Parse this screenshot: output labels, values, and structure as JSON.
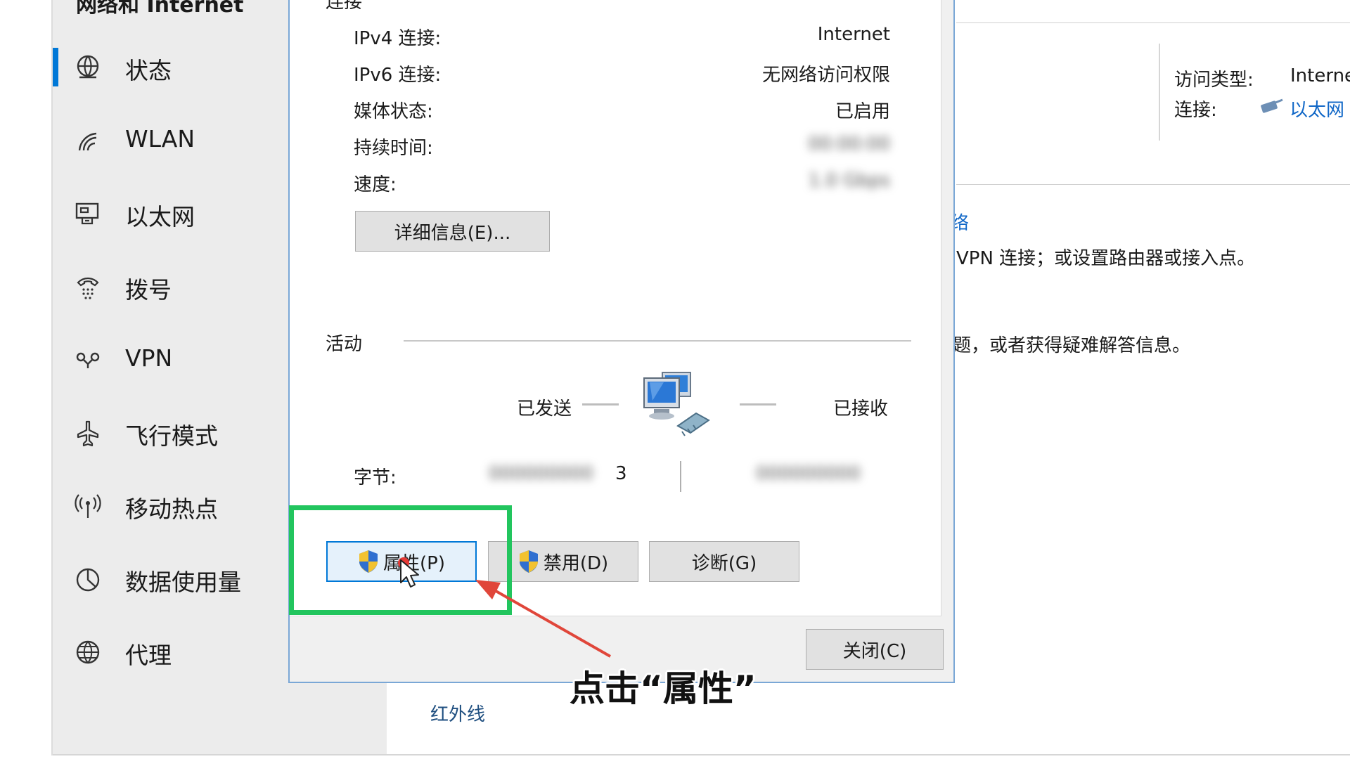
{
  "settings": {
    "nav_header": "网络和 Internet",
    "nav_items": [
      {
        "label": "状态",
        "icon": "globe-status-icon",
        "active": true
      },
      {
        "label": "WLAN",
        "icon": "wifi-icon"
      },
      {
        "label": "以太网",
        "icon": "ethernet-icon"
      },
      {
        "label": "拨号",
        "icon": "dialup-icon"
      },
      {
        "label": "VPN",
        "icon": "vpn-icon"
      },
      {
        "label": "飞行模式",
        "icon": "airplane-icon"
      },
      {
        "label": "移动热点",
        "icon": "hotspot-icon"
      },
      {
        "label": "数据使用量",
        "icon": "data-usage-icon"
      },
      {
        "label": "代理",
        "icon": "globe-icon"
      }
    ],
    "right_panel": {
      "access_type_label": "访问类型:",
      "access_type_value": "Interne",
      "connection_label": "连接:",
      "connection_value": "以太网",
      "link_fragment": "络",
      "desc1": "VPN 连接；或设置路由器或接入点。",
      "desc2": "题，或者获得疑难解答信息。",
      "infrared": "红外线"
    }
  },
  "dialog": {
    "section_connection": "连接",
    "rows": [
      {
        "label": "IPv4 连接:",
        "value": "Internet"
      },
      {
        "label": "IPv6 连接:",
        "value": "无网络访问权限"
      },
      {
        "label": "媒体状态:",
        "value": "已启用"
      },
      {
        "label": "持续时间:",
        "value": "00:00:00"
      },
      {
        "label": "速度:",
        "value": "1.0 Gbps"
      }
    ],
    "details_button": "详细信息(E)...",
    "section_activity": "活动",
    "sent_label": "已发送",
    "received_label": "已接收",
    "bytes_label": "字节:",
    "bytes_sent": "3",
    "bytes_sent_obscured": "000000000",
    "bytes_received_obscured": "000000000",
    "properties_button": "属性(P)",
    "disable_button": "禁用(D)",
    "diagnose_button": "诊断(G)",
    "close_button": "关闭(C)"
  },
  "annotation": {
    "caption": "点击“属性”",
    "highlight_color": "#22c55e",
    "arrow_color": "#e0463a"
  },
  "colors": {
    "accent": "#0078d7",
    "link": "#1067c7"
  }
}
